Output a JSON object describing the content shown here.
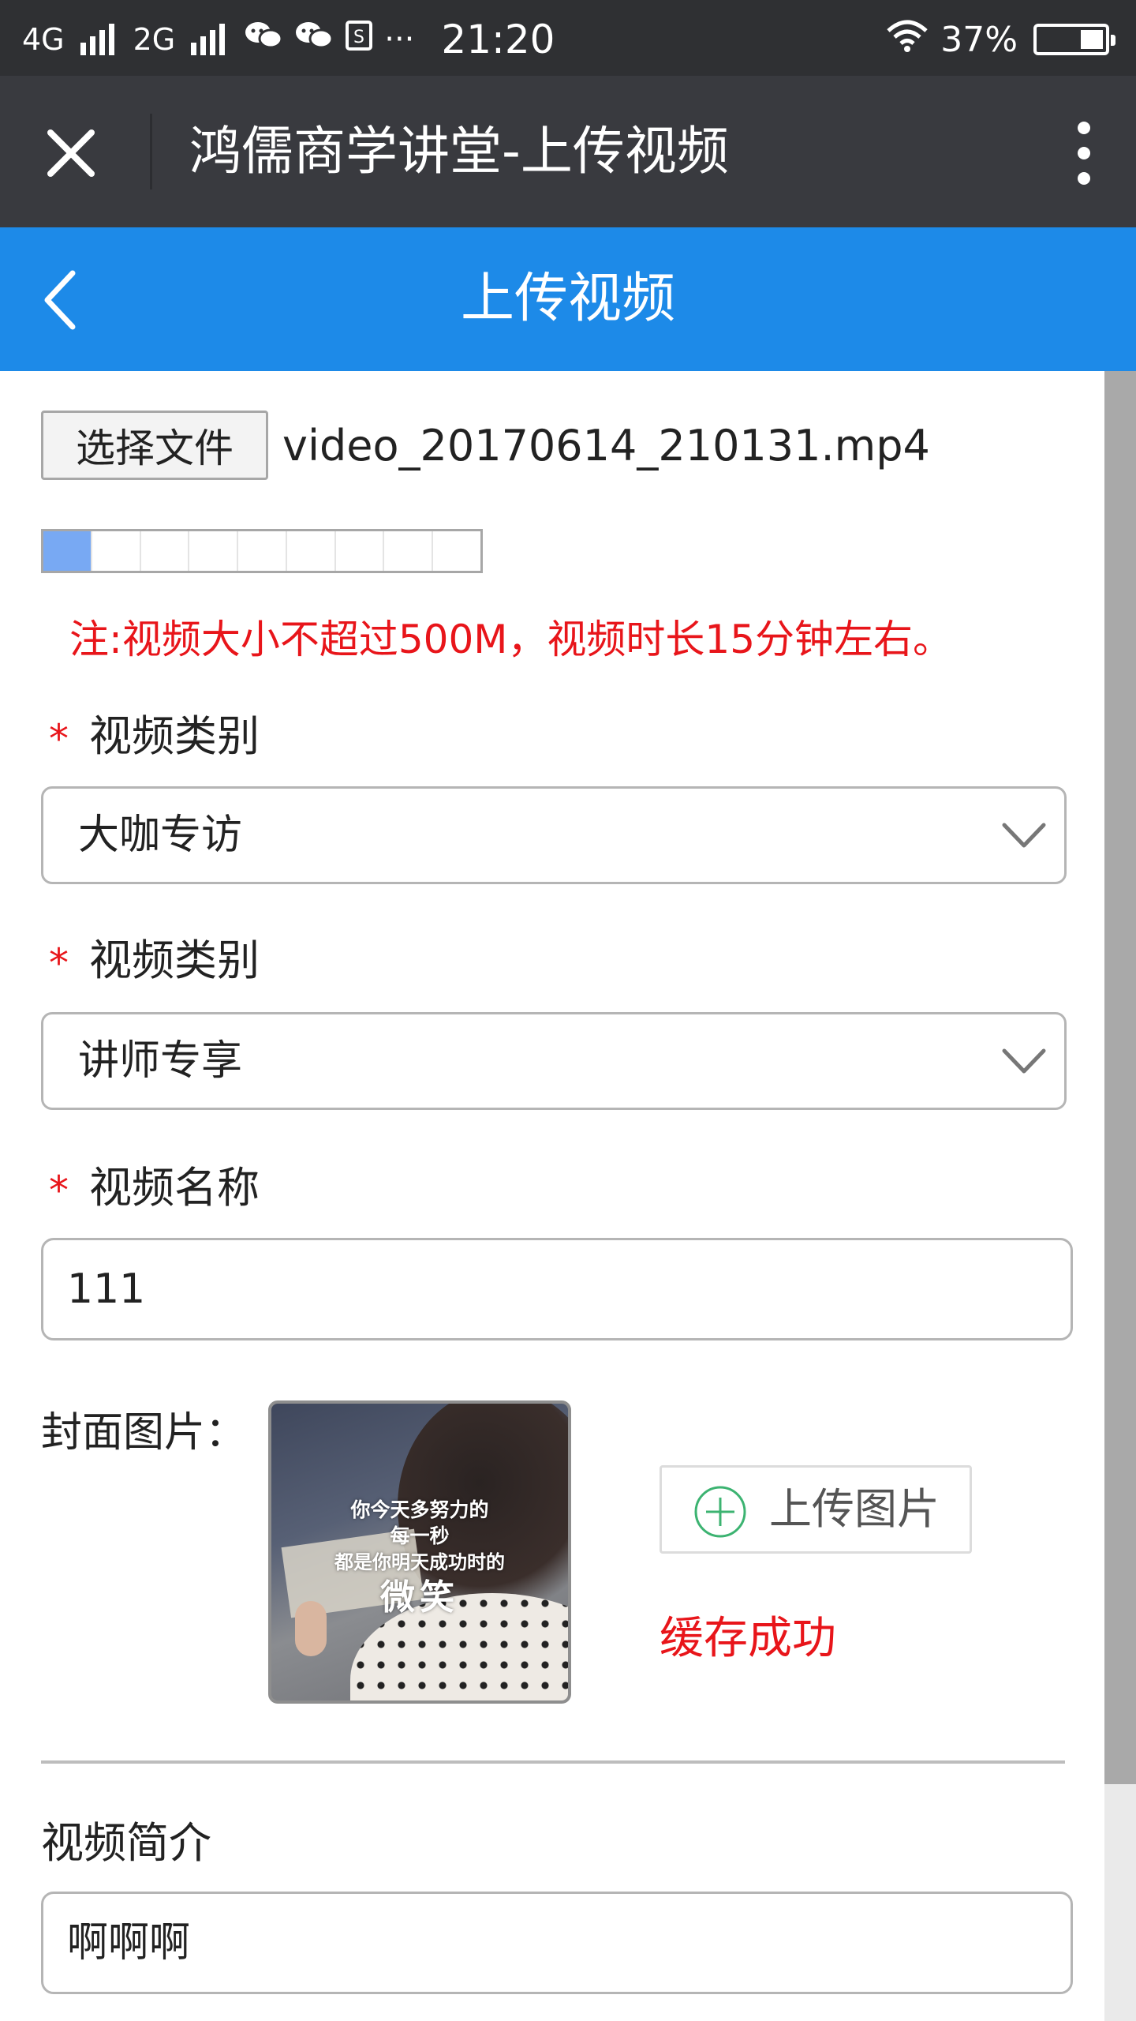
{
  "status_bar": {
    "network1": "4G",
    "network2": "2G",
    "icons": [
      "wechat-icon",
      "wechat-icon",
      "s-app-icon",
      "more-dots-icon",
      "wifi-icon",
      "battery-icon"
    ],
    "dots": "···",
    "time": "21:20",
    "battery": "37%"
  },
  "wechat_bar": {
    "title": "鸿儒商学讲堂-上传视频"
  },
  "header": {
    "title": "上传视频"
  },
  "file": {
    "button_label": "选择文件",
    "file_name": "video_20170614_210131.mp4",
    "progress_fraction": 0.1
  },
  "note": "注:视频大小不超过500M，视频时长15分钟左右。",
  "fields": {
    "category1": {
      "required_mark": "*",
      "label": "视频类别",
      "value": "大咖专访"
    },
    "category2": {
      "required_mark": "*",
      "label": "视频类别",
      "value": "讲师专享"
    },
    "name": {
      "required_mark": "*",
      "label": "视频名称",
      "value": "111"
    },
    "cover": {
      "label": "封面图片：",
      "image_text": [
        "你今天多努力的",
        "每一秒",
        "都是你明天成功时的",
        "微笑"
      ],
      "upload_button": "上传图片",
      "status": "缓存成功"
    },
    "intro": {
      "label": "视频简介",
      "value": "啊啊啊"
    }
  },
  "colors": {
    "status_bar_bg": "#2f3033",
    "wechat_bar_bg": "#393a3f",
    "header_bg": "#1d8ae8",
    "alert_red": "#e8151a",
    "progress_fill": "#78a9f3",
    "upload_plus_green": "#3cb371"
  }
}
